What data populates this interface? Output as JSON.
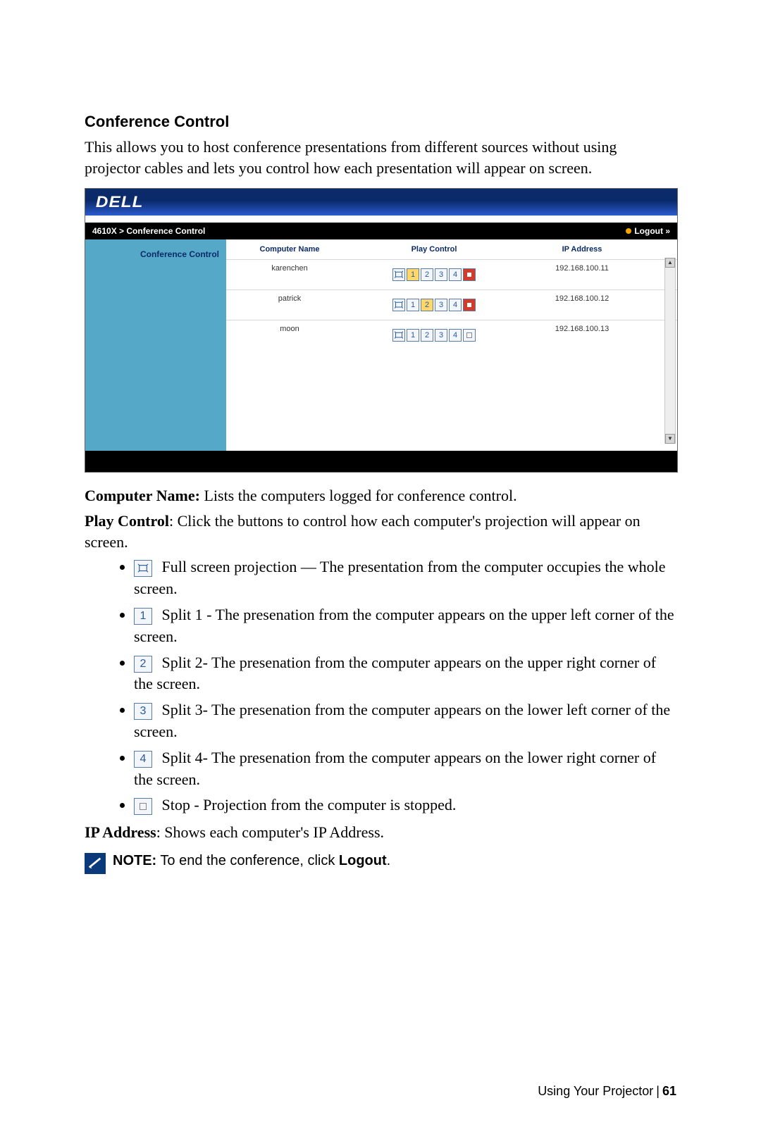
{
  "heading": "Conference Control",
  "intro": "This allows you to host conference presentations from different sources without using projector cables and lets you control how each presentation will appear on screen.",
  "screenshot": {
    "logo": "DELL",
    "breadcrumb": "4610X > Conference Control",
    "logout": "Logout »",
    "left_label": "Conference Control",
    "headers": {
      "name": "Computer Name",
      "play": "Play Control",
      "ip": "IP Address"
    },
    "rows": [
      {
        "name": "karenchen",
        "ip": "192.168.100.11",
        "active": 1,
        "stop_red": true
      },
      {
        "name": "patrick",
        "ip": "192.168.100.12",
        "active": 2,
        "stop_red": true
      },
      {
        "name": "moon",
        "ip": "192.168.100.13",
        "active": 0,
        "stop_red": false
      }
    ]
  },
  "definitions": {
    "computer_name_label": "Computer Name:",
    "computer_name_text": " Lists the computers logged for conference control.",
    "play_control_label": "Play Control",
    "play_control_text": ": Click the buttons to control how each computer's projection will appear on screen.",
    "ip_label": "IP Address",
    "ip_text": ": Shows each computer's IP Address."
  },
  "bullets": [
    {
      "icon": "full",
      "text": " Full screen projection — The presentation from the computer occupies the whole screen."
    },
    {
      "icon": "1",
      "text": " Split 1 - The presenation from the computer appears on the upper left corner of the screen."
    },
    {
      "icon": "2",
      "text": " Split 2- The presenation from the computer appears on the upper right corner of the screen."
    },
    {
      "icon": "3",
      "text": " Split 3- The presenation from the computer appears on the lower left corner of the screen."
    },
    {
      "icon": "4",
      "text": " Split 4- The presenation from the computer appears on the lower right corner of the screen."
    },
    {
      "icon": "stop",
      "text": " Stop - Projection from the computer is stopped."
    }
  ],
  "note": {
    "label": "NOTE:",
    "text": " To end the conference, click ",
    "bold_suffix": "Logout",
    "after": "."
  },
  "footer": {
    "text": "Using Your Projector",
    "page": "61"
  }
}
